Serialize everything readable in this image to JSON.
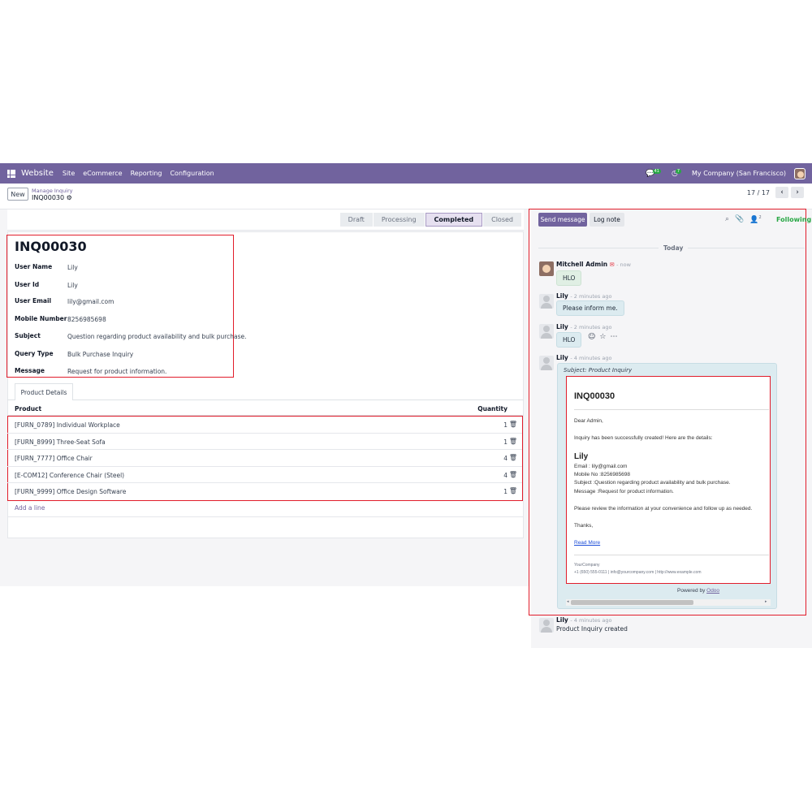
{
  "nav": {
    "brand": "Website",
    "menu": [
      "Site",
      "eCommerce",
      "Reporting",
      "Configuration"
    ],
    "messages_count": "41",
    "activities_count": "7",
    "company": "My Company (San Francisco)"
  },
  "control": {
    "new_label": "New",
    "breadcrumb_parent": "Manage Inquiry",
    "breadcrumb_current": "INQ00030",
    "pager": "17 / 17"
  },
  "stages": [
    "Draft",
    "Processing",
    "Completed",
    "Closed"
  ],
  "active_stage": "Completed",
  "form": {
    "title": "INQ00030",
    "fields": [
      {
        "label": "User Name",
        "value": "Lily"
      },
      {
        "label": "User Id",
        "value": "Lily"
      },
      {
        "label": "User Email",
        "value": "lily@gmail.com"
      },
      {
        "label": "Mobile Number",
        "value": "8256985698"
      },
      {
        "label": "Subject",
        "value": "Question regarding product availability and bulk purchase."
      },
      {
        "label": "Query Type",
        "value": "Bulk Purchase Inquiry"
      },
      {
        "label": "Message",
        "value": "Request for product information."
      }
    ],
    "tab_label": "Product Details",
    "columns": {
      "product": "Product",
      "quantity": "Quantity"
    },
    "lines": [
      {
        "product": "[FURN_0789] Individual Workplace",
        "quantity": "1"
      },
      {
        "product": "[FURN_8999] Three-Seat Sofa",
        "quantity": "1"
      },
      {
        "product": "[FURN_7777] Office Chair",
        "quantity": "4"
      },
      {
        "product": "[E-COM12] Conference Chair (Steel)",
        "quantity": "4"
      },
      {
        "product": "[FURN_9999] Office Design Software",
        "quantity": "1"
      }
    ],
    "add_line": "Add a line"
  },
  "chatter": {
    "send_message": "Send message",
    "log_note": "Log note",
    "followers_count": "2",
    "following": "Following",
    "today": "Today",
    "messages": [
      {
        "author": "Mitchell Admin",
        "time": "- now",
        "body": "HLO"
      },
      {
        "author": "Lily",
        "time": "- 2 minutes ago",
        "body": "Please inform me."
      },
      {
        "author": "Lily",
        "time": "- 2 minutes ago",
        "body": "HLO"
      },
      {
        "author": "Lily",
        "time": "- 4 minutes ago",
        "body": ""
      },
      {
        "author": "Lily",
        "time": "- 4 minutes ago",
        "body": "Product Inquiry created"
      }
    ],
    "email": {
      "subject": "Subject: Product Inquiry",
      "title": "INQ00030",
      "greeting": "Dear Admin,",
      "intro": "Inquiry has been successfully created! Here are the details:",
      "name": "Lily",
      "email_line": "Email : lily@gmail.com",
      "mobile_line": "Mobile No :8256985698",
      "subject_line": "Subject :Question regarding product availability and bulk purchase.",
      "message_line": "Message :Request for product information.",
      "review": "Please review the information at your convenience and follow up as needed.",
      "thanks": "Thanks,",
      "read_more": "Read More",
      "company": "YourCompany",
      "contact": "+1 (650) 555-0111 | info@yourcompany.com | http://www.example.com",
      "powered_by": "Powered by",
      "powered_link": "Odoo"
    }
  }
}
